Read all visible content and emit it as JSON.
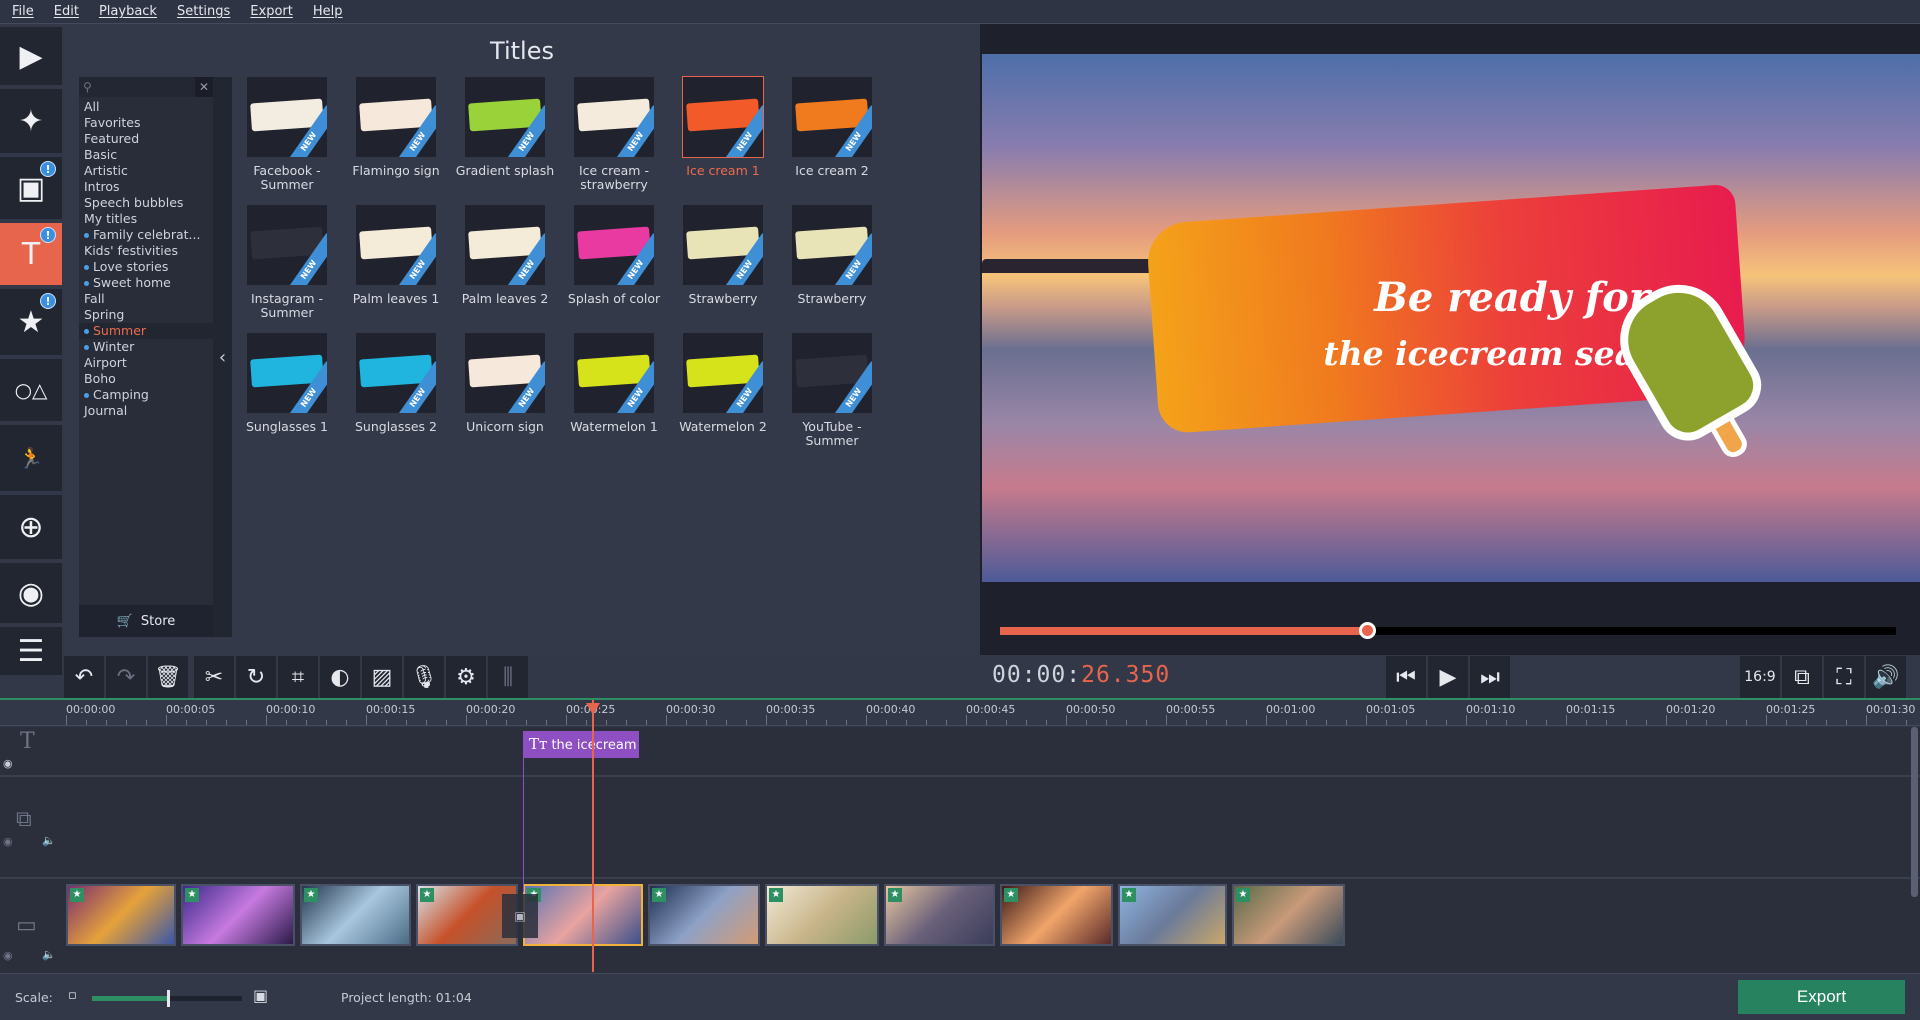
{
  "menu": [
    "File",
    "Edit",
    "Playback",
    "Settings",
    "Export",
    "Help"
  ],
  "sidebar": [
    {
      "icon": "film-import-icon",
      "glyph": "▶"
    },
    {
      "icon": "magic-wand-icon",
      "glyph": "✦"
    },
    {
      "icon": "filters-icon",
      "glyph": "▣",
      "badge": "!"
    },
    {
      "icon": "titles-icon",
      "glyph": "T",
      "badge": "!",
      "active": true
    },
    {
      "icon": "stickers-icon",
      "glyph": "★",
      "badge": "!"
    },
    {
      "icon": "transitions-shapes-icon",
      "glyph": "○△"
    },
    {
      "icon": "motion-icon",
      "glyph": "🏃"
    },
    {
      "icon": "zoom-pan-icon",
      "glyph": "⊕"
    },
    {
      "icon": "capture-icon",
      "glyph": "◉"
    },
    {
      "icon": "more-list-icon",
      "glyph": "☰"
    }
  ],
  "titles_panel": {
    "title": "Titles",
    "search_placeholder": "",
    "categories": [
      {
        "label": "All"
      },
      {
        "label": "Favorites"
      },
      {
        "label": "Featured"
      },
      {
        "label": "Basic"
      },
      {
        "label": "Artistic"
      },
      {
        "label": "Intros"
      },
      {
        "label": "Speech bubbles"
      },
      {
        "label": "My titles"
      },
      {
        "label": "Family celebrat...",
        "dot": true
      },
      {
        "label": "Kids' festivities"
      },
      {
        "label": "Love stories",
        "dot": true
      },
      {
        "label": "Sweet home",
        "dot": true
      },
      {
        "label": "Fall"
      },
      {
        "label": "Spring"
      },
      {
        "label": "Summer",
        "dot": true,
        "selected": true
      },
      {
        "label": "Winter",
        "dot": true
      },
      {
        "label": "Airport"
      },
      {
        "label": "Boho"
      },
      {
        "label": "Camping",
        "dot": true
      },
      {
        "label": "Journal"
      }
    ],
    "store_label": "Store",
    "new_badge": "NEW",
    "items": [
      {
        "label": "Facebook - Summer",
        "color": "#f3ece0"
      },
      {
        "label": "Flamingo sign",
        "color": "#f6e8da"
      },
      {
        "label": "Gradient splash",
        "color": "#9ad23a"
      },
      {
        "label": "Ice cream - strawberry",
        "color": "#f5ebdc"
      },
      {
        "label": "Ice cream 1",
        "color": "#f25a2a",
        "selected": true
      },
      {
        "label": "Ice cream 2",
        "color": "#f07a1e"
      },
      {
        "label": "Instagram - Summer",
        "color": "#2d2f3a"
      },
      {
        "label": "Palm leaves 1",
        "color": "#f4ebd8"
      },
      {
        "label": "Palm leaves 2",
        "color": "#f4ebd8"
      },
      {
        "label": "Splash of color",
        "color": "#e83aa0"
      },
      {
        "label": "Strawberry",
        "color": "#e9e3b8"
      },
      {
        "label": "Strawberry",
        "color": "#e9e3b8"
      },
      {
        "label": "Sunglasses 1",
        "color": "#1fb5de"
      },
      {
        "label": "Sunglasses 2",
        "color": "#1fb5de"
      },
      {
        "label": "Unicorn sign",
        "color": "#f6e8da"
      },
      {
        "label": "Watermelon 1",
        "color": "#d6e21a"
      },
      {
        "label": "Watermelon 2",
        "color": "#d6e21a"
      },
      {
        "label": "YouTube - Summer",
        "color": "#2d2f3a"
      }
    ]
  },
  "preview": {
    "line1": "Be ready for",
    "line2": "the icecream season",
    "progress_percent": 41,
    "timecode_prefix": "00:00:",
    "timecode_value": "26.350",
    "aspect_label": "16:9"
  },
  "toolbar": [
    "undo-icon",
    "redo-icon",
    "delete-icon",
    "cut-icon",
    "rotate-icon",
    "crop-icon",
    "color-adjust-icon",
    "image-icon",
    "microphone-icon",
    "settings-icon",
    "equalizer-icon"
  ],
  "toolbar_glyphs": [
    "↶",
    "↷",
    "🗑",
    "✂",
    "↻",
    "⌗",
    "◐",
    "▨",
    "🎙",
    "⚙",
    "⫼"
  ],
  "timeline": {
    "ticks": [
      "00:00:00",
      "00:00:05",
      "00:00:10",
      "00:00:15",
      "00:00:20",
      "00:00:25",
      "00:00:30",
      "00:00:35",
      "00:00:40",
      "00:00:45",
      "00:00:50",
      "00:00:55",
      "00:01:00",
      "00:01:05",
      "00:01:10",
      "00:01:15",
      "00:01:20",
      "00:01:25",
      "00:01:30"
    ],
    "playhead_seconds": 26.35,
    "text_clip": {
      "label": "the icecream",
      "start_seconds": 22.85
    },
    "clips": [
      {
        "colors": [
          "#7a2f6e",
          "#e6a23a",
          "#3a56a8"
        ]
      },
      {
        "colors": [
          "#3a2a8a",
          "#c77ae0",
          "#2a1b4a"
        ]
      },
      {
        "colors": [
          "#23364f",
          "#a9c8df",
          "#4b6a86"
        ]
      },
      {
        "colors": [
          "#d9e3ea",
          "#c5512a",
          "#8a6b5a"
        ]
      },
      {
        "colors": [
          "#5a74b5",
          "#e8a3a0",
          "#3b4f8a"
        ],
        "selected": true
      },
      {
        "colors": [
          "#1d2f52",
          "#8ea1c6",
          "#d39b74"
        ]
      },
      {
        "colors": [
          "#f0ead8",
          "#c9b58a",
          "#8b9a6a"
        ]
      },
      {
        "colors": [
          "#e8c7a0",
          "#6a607a",
          "#3a3d5a"
        ]
      },
      {
        "colors": [
          "#3a1a1a",
          "#f1a56a",
          "#5a2a2a"
        ]
      },
      {
        "colors": [
          "#8fb4e0",
          "#6a7a9a",
          "#c8a76a"
        ]
      },
      {
        "colors": [
          "#5a6a4a",
          "#c89a7a",
          "#3a4a5a"
        ]
      }
    ]
  },
  "bottom": {
    "scale_label": "Scale:",
    "scale_percent": 50,
    "project_length": "Project length:  01:04",
    "export_label": "Export"
  }
}
